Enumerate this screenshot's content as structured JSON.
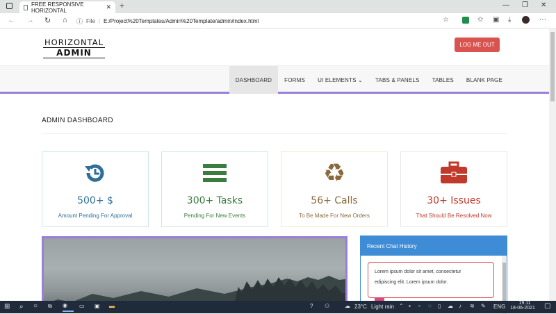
{
  "browser": {
    "tab_title": "FREE RESPONSIVE HORIZONTAL",
    "url_label": "File",
    "url": "E:/Project%20Templates/Admin%20Template/admin/index.html"
  },
  "header": {
    "logo_line1": "HORIZONTAL",
    "logo_line2": "ADMIN",
    "logout_label": "LOG ME OUT"
  },
  "menu": {
    "items": [
      {
        "label": "DASHBOARD"
      },
      {
        "label": "FORMS"
      },
      {
        "label": "UI ELEMENTS ⌄"
      },
      {
        "label": "TABS & PANELS"
      },
      {
        "label": "TABLES"
      },
      {
        "label": "BLANK PAGE"
      }
    ]
  },
  "page": {
    "title": "ADMIN DASHBOARD"
  },
  "cards": [
    {
      "number": "500+  $",
      "subtitle": "Amount Pending For Approval",
      "color": "#2f6f9a",
      "icon": "history-icon"
    },
    {
      "number": "300+ Tasks",
      "subtitle": "Pending For New Events",
      "color": "#3a7d3f",
      "icon": "list-icon"
    },
    {
      "number": "56+ Calls",
      "subtitle": "To Be Made For New Orders",
      "color": "#8a6a3c",
      "icon": "recycle-icon"
    },
    {
      "number": "30+ Issues",
      "subtitle": "That Should Be Resolved Now",
      "color": "#c0392b",
      "icon": "briefcase-icon"
    }
  ],
  "chat": {
    "title": "Recent Chat History",
    "message_line1": "Lorem ipsum dolor sit amet, consectetur",
    "message_line2": "edipiscing elit. Lorem ipsum dolor."
  },
  "taskbar": {
    "weather": "23°C",
    "condition": "Light rain",
    "lang": "ENG",
    "time": "19:11",
    "date": "18-06-2021"
  }
}
